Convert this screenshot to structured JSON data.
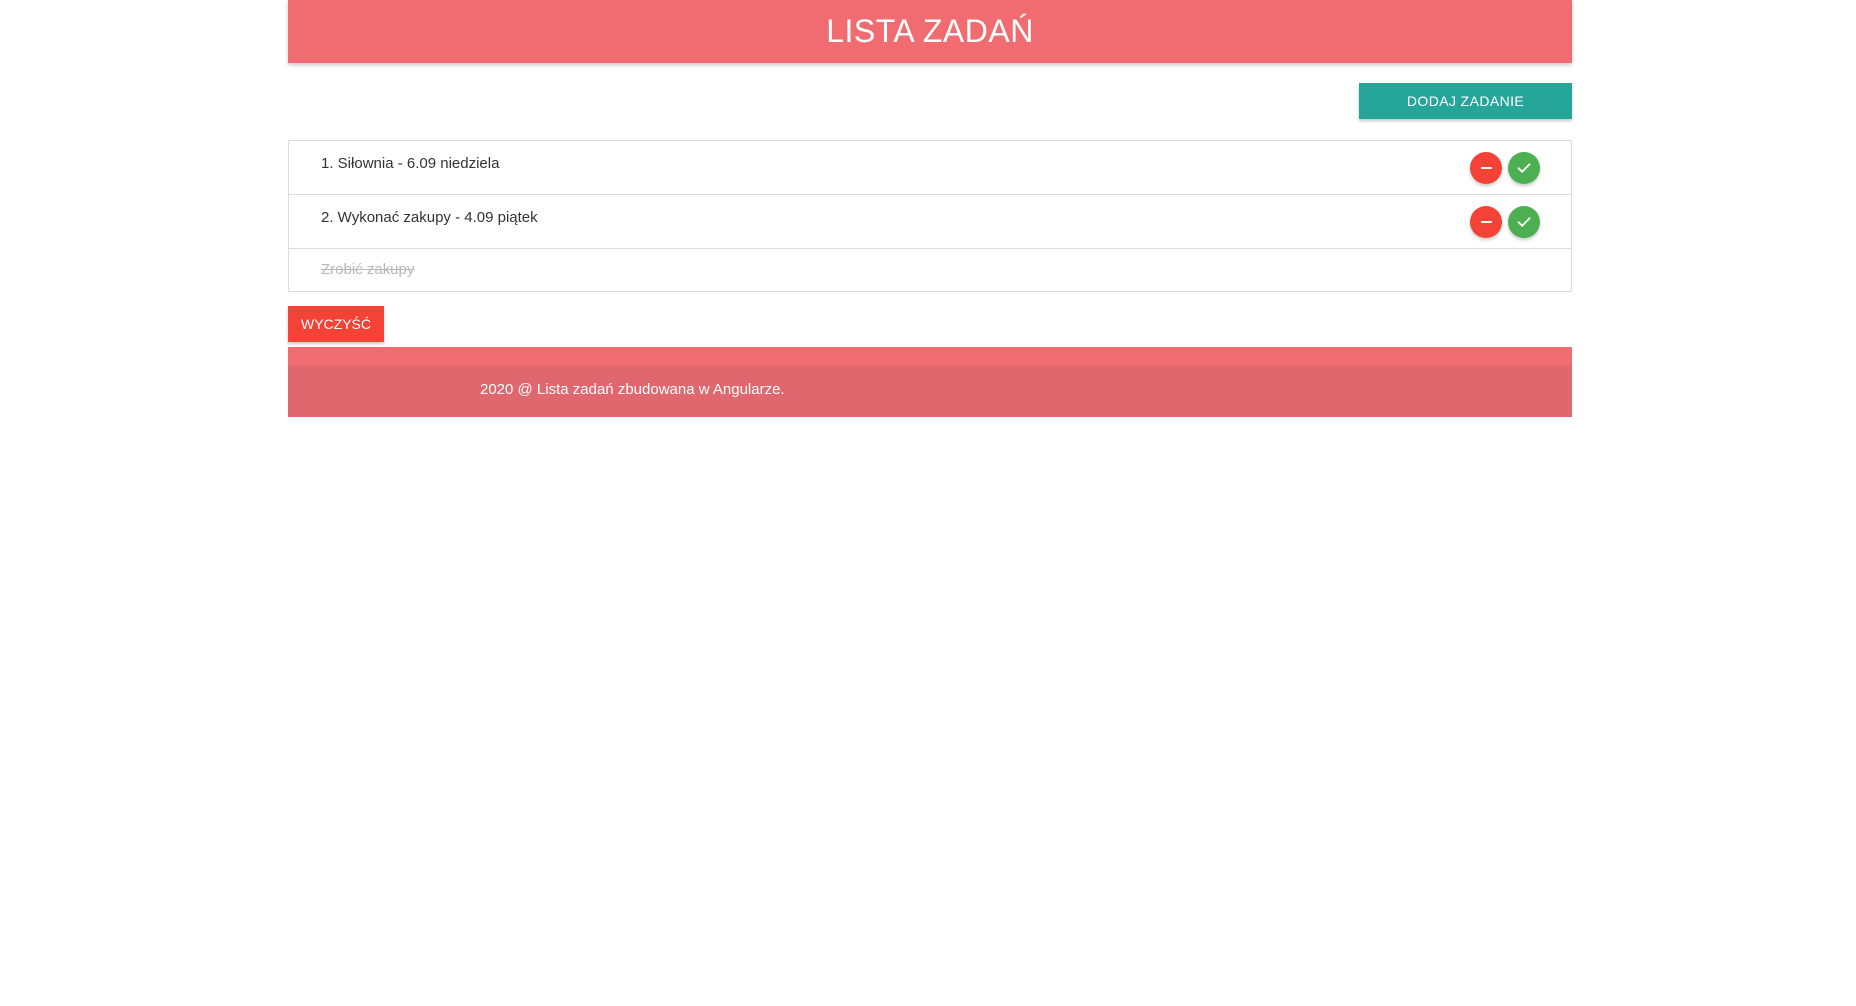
{
  "header": {
    "title": "LISTA ZADAŃ"
  },
  "toolbar": {
    "add_label": "DODAJ ZADANIE"
  },
  "tasks": [
    {
      "text": "1. Siłownia - 6.09 niedziela",
      "done": false
    },
    {
      "text": "2. Wykonać zakupy - 4.09 piątek",
      "done": false
    },
    {
      "text": "Zrobić zakupy",
      "done": true
    }
  ],
  "actions": {
    "clear_label": "WYCZYŚĆ"
  },
  "footer": {
    "text": "2020 @ Lista zadań zbudowana w Angularze."
  },
  "colors": {
    "header": "#f06c71",
    "add_button": "#26a69a",
    "remove_button": "#f44336",
    "done_button": "#4caf50",
    "clear_button": "#f44336",
    "footer": "#e0676d"
  },
  "icons": {
    "remove": "minus-icon",
    "done": "check-icon"
  }
}
